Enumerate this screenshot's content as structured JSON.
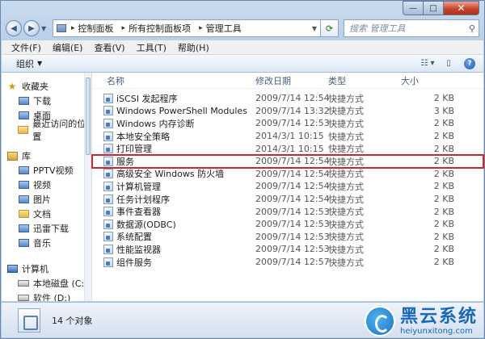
{
  "caption": {
    "minimize": "—",
    "maximize": "□",
    "close": "✕"
  },
  "address": {
    "crumbs": [
      "控制面板",
      "所有控制面板项",
      "管理工具"
    ],
    "search_placeholder": "搜索 管理工具"
  },
  "menu": [
    "文件(F)",
    "编辑(E)",
    "查看(V)",
    "工具(T)",
    "帮助(H)"
  ],
  "toolbar": {
    "organize": "组织"
  },
  "nav": {
    "favorites": {
      "label": "收藏夹",
      "items": [
        "下载",
        "桌面",
        "最近访问的位置"
      ]
    },
    "libraries": {
      "label": "库",
      "items": [
        "PPTV视频",
        "视频",
        "图片",
        "文档",
        "迅雷下载",
        "音乐"
      ]
    },
    "computer": {
      "label": "计算机",
      "items": [
        "本地磁盘 (C:)",
        "软件 (D:)"
      ]
    }
  },
  "columns": {
    "name": "名称",
    "date": "修改日期",
    "type": "类型",
    "size": "大小"
  },
  "files": [
    {
      "name": "iSCSI 发起程序",
      "date": "2009/7/14 12:54",
      "type": "快捷方式",
      "size": "2 KB"
    },
    {
      "name": "Windows PowerShell Modules",
      "date": "2009/7/14 13:32",
      "type": "快捷方式",
      "size": "3 KB"
    },
    {
      "name": "Windows 内存诊断",
      "date": "2009/7/14 12:53",
      "type": "快捷方式",
      "size": "2 KB"
    },
    {
      "name": "本地安全策略",
      "date": "2014/3/1 10:15",
      "type": "快捷方式",
      "size": "2 KB"
    },
    {
      "name": "打印管理",
      "date": "2014/3/1 10:15",
      "type": "快捷方式",
      "size": "2 KB"
    },
    {
      "name": "服务",
      "date": "2009/7/14 12:54",
      "type": "快捷方式",
      "size": "2 KB"
    },
    {
      "name": "高级安全 Windows 防火墙",
      "date": "2009/7/14 12:54",
      "type": "快捷方式",
      "size": "2 KB"
    },
    {
      "name": "计算机管理",
      "date": "2009/7/14 12:54",
      "type": "快捷方式",
      "size": "2 KB"
    },
    {
      "name": "任务计划程序",
      "date": "2009/7/14 12:54",
      "type": "快捷方式",
      "size": "2 KB"
    },
    {
      "name": "事件查看器",
      "date": "2009/7/14 12:53",
      "type": "快捷方式",
      "size": "2 KB"
    },
    {
      "name": "数据源(ODBC)",
      "date": "2009/7/14 12:53",
      "type": "快捷方式",
      "size": "2 KB"
    },
    {
      "name": "系统配置",
      "date": "2009/7/14 12:53",
      "type": "快捷方式",
      "size": "2 KB"
    },
    {
      "name": "性能监视器",
      "date": "2009/7/14 12:53",
      "type": "快捷方式",
      "size": "2 KB"
    },
    {
      "name": "组件服务",
      "date": "2009/7/14 12:57",
      "type": "快捷方式",
      "size": "2 KB"
    }
  ],
  "status": {
    "count": "14 个对象"
  },
  "watermark": {
    "title": "黑云系统",
    "url": "heiyunxitong.com"
  },
  "colors": {
    "highlight": "#d4242a",
    "accent": "#1a68b8"
  }
}
